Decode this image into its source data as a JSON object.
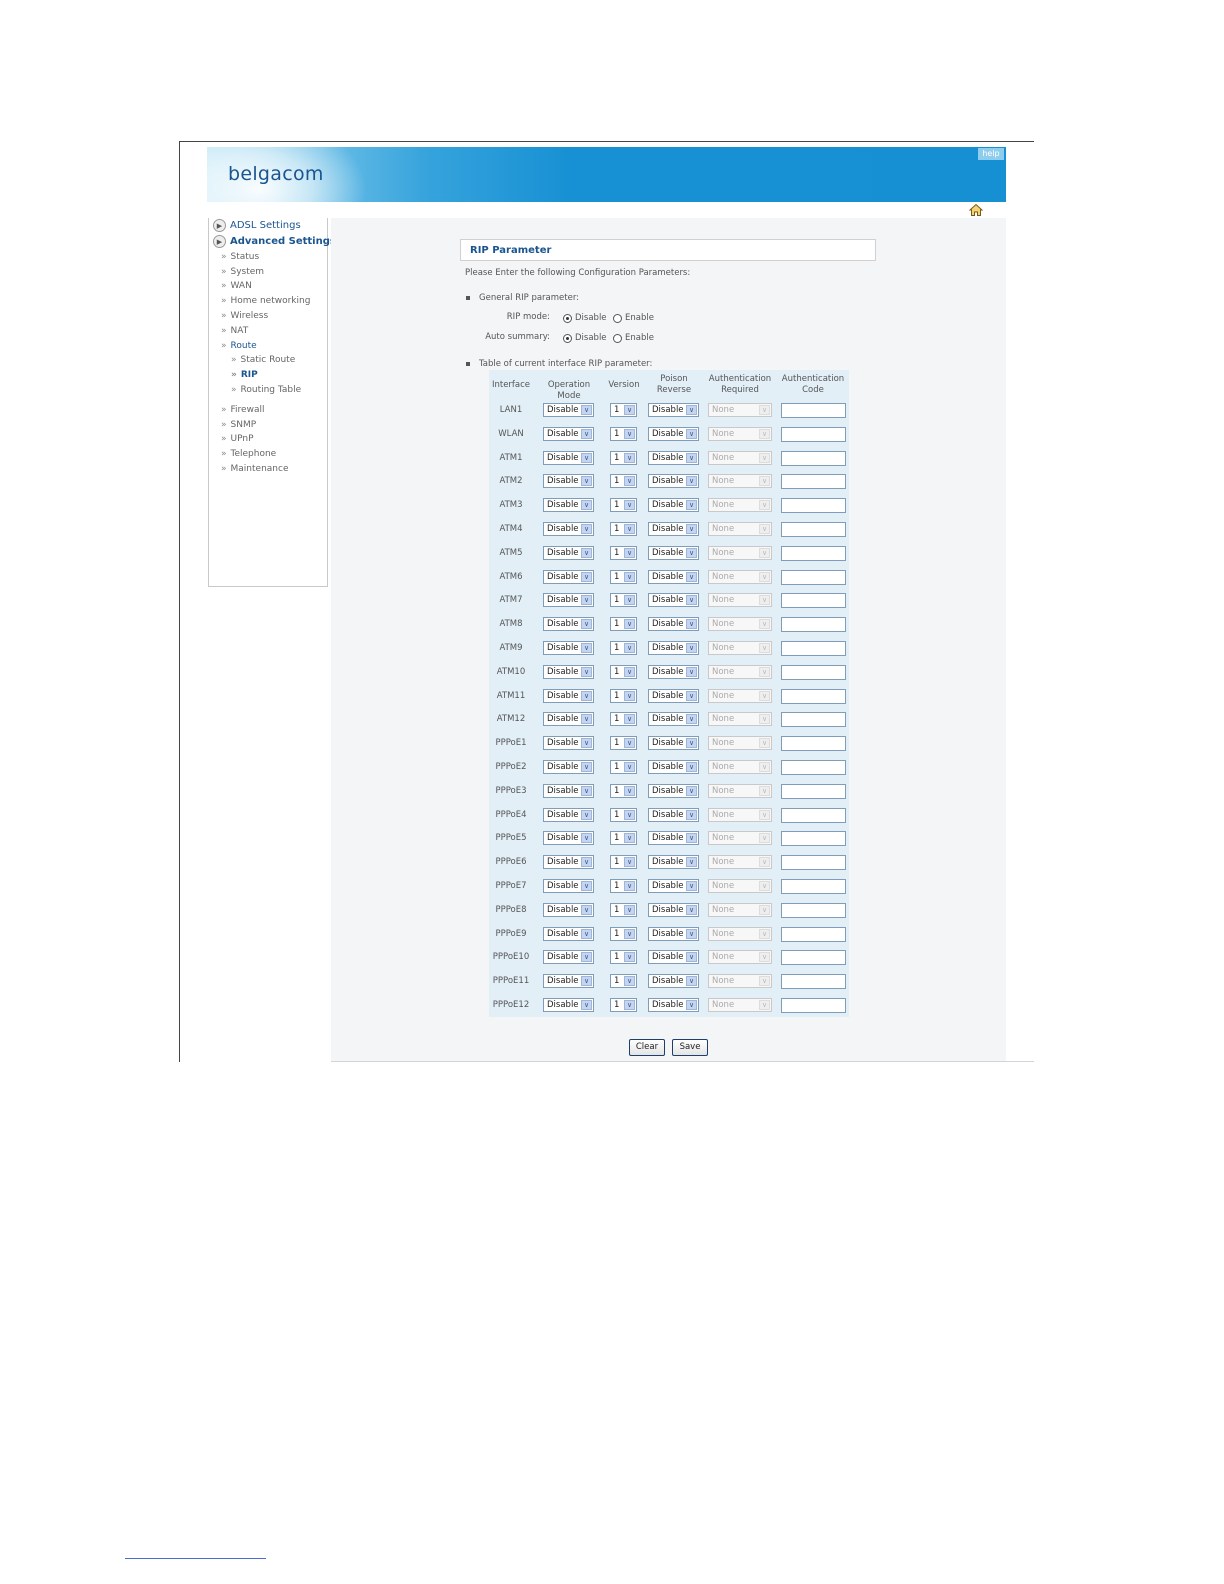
{
  "header": {
    "logo": "belgacom",
    "help": "help"
  },
  "sidebar": {
    "groups": [
      "ADSL Settings",
      "Advanced Settings"
    ],
    "items": [
      "Status",
      "System",
      "WAN",
      "Home networking",
      "Wireless",
      "NAT",
      "Route"
    ],
    "route_children": [
      "Static Route",
      "RIP",
      "Routing Table"
    ],
    "items_after": [
      "Firewall",
      "SNMP",
      "UPnP",
      "Telephone",
      "Maintenance"
    ],
    "active": "RIP"
  },
  "page": {
    "title": "RIP Parameter",
    "intro": "Please Enter the following Configuration Parameters:",
    "general_heading": "General RIP parameter:",
    "rip_mode_label": "RIP mode:",
    "auto_summary_label": "Auto summary:",
    "radio_disable": "Disable",
    "radio_enable": "Enable",
    "rip_mode_value": "Disable",
    "auto_summary_value": "Disable",
    "table_heading": "Table of current interface RIP parameter:"
  },
  "table": {
    "headers": {
      "interface": "Interface",
      "operation_mode": "Operation Mode",
      "version": "Version",
      "poison_reverse_1": "Poison",
      "poison_reverse_2": "Reverse",
      "auth_required_1": "Authentication",
      "auth_required_2": "Required",
      "auth_code_1": "Authentication",
      "auth_code_2": "Code"
    },
    "rows": [
      {
        "interface": "LAN1",
        "mode": "Disable",
        "version": "1",
        "poison": "Disable",
        "auth": "None",
        "code": ""
      },
      {
        "interface": "WLAN",
        "mode": "Disable",
        "version": "1",
        "poison": "Disable",
        "auth": "None",
        "code": ""
      },
      {
        "interface": "ATM1",
        "mode": "Disable",
        "version": "1",
        "poison": "Disable",
        "auth": "None",
        "code": ""
      },
      {
        "interface": "ATM2",
        "mode": "Disable",
        "version": "1",
        "poison": "Disable",
        "auth": "None",
        "code": ""
      },
      {
        "interface": "ATM3",
        "mode": "Disable",
        "version": "1",
        "poison": "Disable",
        "auth": "None",
        "code": ""
      },
      {
        "interface": "ATM4",
        "mode": "Disable",
        "version": "1",
        "poison": "Disable",
        "auth": "None",
        "code": ""
      },
      {
        "interface": "ATM5",
        "mode": "Disable",
        "version": "1",
        "poison": "Disable",
        "auth": "None",
        "code": ""
      },
      {
        "interface": "ATM6",
        "mode": "Disable",
        "version": "1",
        "poison": "Disable",
        "auth": "None",
        "code": ""
      },
      {
        "interface": "ATM7",
        "mode": "Disable",
        "version": "1",
        "poison": "Disable",
        "auth": "None",
        "code": ""
      },
      {
        "interface": "ATM8",
        "mode": "Disable",
        "version": "1",
        "poison": "Disable",
        "auth": "None",
        "code": ""
      },
      {
        "interface": "ATM9",
        "mode": "Disable",
        "version": "1",
        "poison": "Disable",
        "auth": "None",
        "code": ""
      },
      {
        "interface": "ATM10",
        "mode": "Disable",
        "version": "1",
        "poison": "Disable",
        "auth": "None",
        "code": ""
      },
      {
        "interface": "ATM11",
        "mode": "Disable",
        "version": "1",
        "poison": "Disable",
        "auth": "None",
        "code": ""
      },
      {
        "interface": "ATM12",
        "mode": "Disable",
        "version": "1",
        "poison": "Disable",
        "auth": "None",
        "code": ""
      },
      {
        "interface": "PPPoE1",
        "mode": "Disable",
        "version": "1",
        "poison": "Disable",
        "auth": "None",
        "code": ""
      },
      {
        "interface": "PPPoE2",
        "mode": "Disable",
        "version": "1",
        "poison": "Disable",
        "auth": "None",
        "code": ""
      },
      {
        "interface": "PPPoE3",
        "mode": "Disable",
        "version": "1",
        "poison": "Disable",
        "auth": "None",
        "code": ""
      },
      {
        "interface": "PPPoE4",
        "mode": "Disable",
        "version": "1",
        "poison": "Disable",
        "auth": "None",
        "code": ""
      },
      {
        "interface": "PPPoE5",
        "mode": "Disable",
        "version": "1",
        "poison": "Disable",
        "auth": "None",
        "code": ""
      },
      {
        "interface": "PPPoE6",
        "mode": "Disable",
        "version": "1",
        "poison": "Disable",
        "auth": "None",
        "code": ""
      },
      {
        "interface": "PPPoE7",
        "mode": "Disable",
        "version": "1",
        "poison": "Disable",
        "auth": "None",
        "code": ""
      },
      {
        "interface": "PPPoE8",
        "mode": "Disable",
        "version": "1",
        "poison": "Disable",
        "auth": "None",
        "code": ""
      },
      {
        "interface": "PPPoE9",
        "mode": "Disable",
        "version": "1",
        "poison": "Disable",
        "auth": "None",
        "code": ""
      },
      {
        "interface": "PPPoE10",
        "mode": "Disable",
        "version": "1",
        "poison": "Disable",
        "auth": "None",
        "code": ""
      },
      {
        "interface": "PPPoE11",
        "mode": "Disable",
        "version": "1",
        "poison": "Disable",
        "auth": "None",
        "code": ""
      },
      {
        "interface": "PPPoE12",
        "mode": "Disable",
        "version": "1",
        "poison": "Disable",
        "auth": "None",
        "code": ""
      }
    ]
  },
  "buttons": {
    "clear": "Clear",
    "save": "Save"
  },
  "icons": {
    "home": "home-icon",
    "logout": "logout-icon"
  },
  "colors": {
    "brand": "#1b5590",
    "banner": "#1690d3",
    "table_bg": "#e2eff7"
  }
}
